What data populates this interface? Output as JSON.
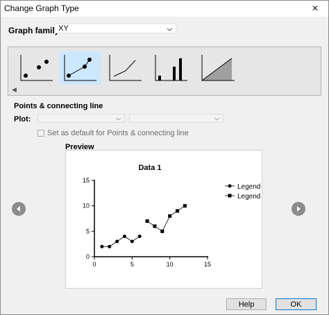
{
  "window": {
    "title": "Change Graph Type",
    "close_glyph": "✕"
  },
  "graph_family": {
    "label": "Graph family:",
    "value": "XY"
  },
  "gallery": {
    "items": [
      {
        "name": "points"
      },
      {
        "name": "points-connecting-line",
        "selected": true
      },
      {
        "name": "line-only"
      },
      {
        "name": "spikes"
      },
      {
        "name": "area-fill"
      }
    ]
  },
  "section": {
    "title": "Points & connecting line"
  },
  "plot": {
    "label": "Plot:",
    "value1": "",
    "value2": ""
  },
  "default_checkbox": {
    "label": "Set as default for Points & connecting line",
    "checked": false
  },
  "preview": {
    "label": "Preview",
    "chart_data": {
      "type": "line",
      "title": "Data 1",
      "xlabel": "",
      "ylabel": "",
      "xlim": [
        0,
        15
      ],
      "ylim": [
        0,
        15
      ],
      "x_ticks": [
        0,
        5,
        10,
        15
      ],
      "y_ticks": [
        0,
        5,
        10,
        15
      ],
      "grid": false,
      "legend_placement": "right",
      "series": [
        {
          "name": "Legend",
          "marker": "circle",
          "x": [
            1,
            2,
            3,
            4,
            5,
            6
          ],
          "y": [
            2,
            2,
            3,
            4,
            3,
            4
          ]
        },
        {
          "name": "Legend",
          "marker": "square",
          "x": [
            7,
            8,
            9,
            10,
            11,
            12
          ],
          "y": [
            7,
            6,
            5,
            8,
            9,
            10
          ]
        }
      ]
    }
  },
  "buttons": {
    "help": "Help",
    "ok": "OK"
  },
  "colors": {
    "selection": "#cce8ff",
    "nav_button": "#8b8b8b",
    "ok_border": "#0078d7",
    "area_fill": "#a0a0a0"
  }
}
